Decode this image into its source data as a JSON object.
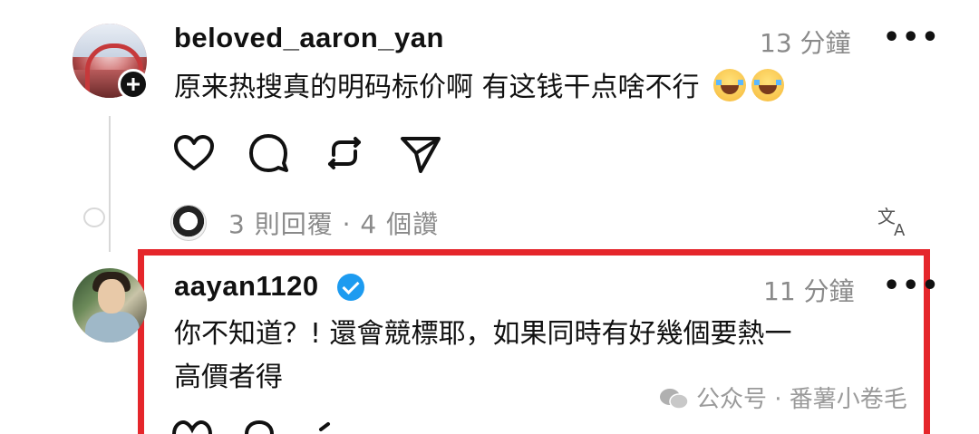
{
  "comments": [
    {
      "username": "beloved_aaron_yan",
      "time": "13 分鐘",
      "text": "原来热搜真的明码标价啊 有这钱干点啥不行",
      "emojis": [
        "face-with-tears-of-joy",
        "face-with-tears-of-joy"
      ],
      "reply_info": "3 則回覆 · 4 個讚"
    },
    {
      "username": "aayan1120",
      "verified": true,
      "time": "11 分鐘",
      "text_line1": "你不知道？! 還會競標耶，如果同時有好幾個要熱一",
      "text_line2": "高價者得"
    }
  ],
  "more_label": "•••",
  "watermark": "公众号 · 番薯小卷毛",
  "colors": {
    "highlight": "#e5262b",
    "verified": "#1d9bf0",
    "muted_text": "#8a8a8a"
  },
  "icons": [
    "heart-icon",
    "comment-icon",
    "repost-icon",
    "share-icon",
    "translate-icon",
    "wechat-icon"
  ]
}
